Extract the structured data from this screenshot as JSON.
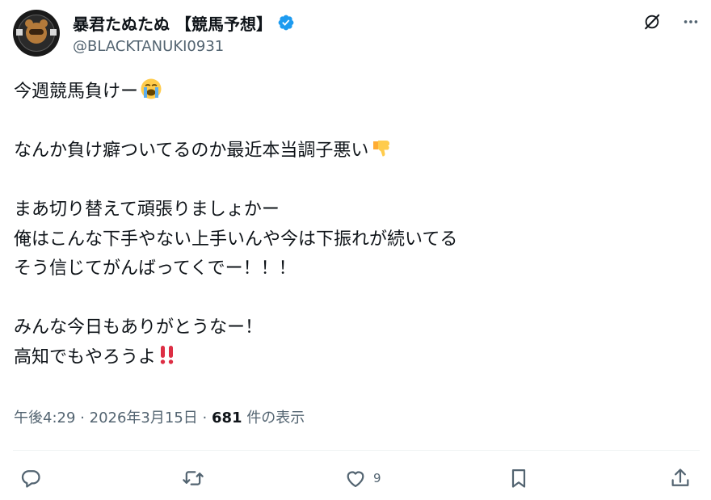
{
  "author": {
    "display_name": "暴君たぬたぬ 【競馬予想】",
    "handle": "@BLACKTANUKI0931",
    "verified": true
  },
  "tweet": {
    "lines": [
      "今週競馬負けー",
      "",
      "なんか負け癖ついてるのか最近本当調子悪い",
      "",
      "まあ切り替えて頑張りましょかー",
      "俺はこんな下手やない上手いんや今は下振れが続いてる",
      "そう信じてがんばってくでー！！！",
      "",
      "みんな今日もありがとうなー！",
      "高知でもやろうよ"
    ]
  },
  "meta": {
    "time": "午後4:29",
    "date": "2026年3月15日",
    "separator": "·",
    "views_count": "681",
    "views_label": "件の表示"
  },
  "actions": {
    "reply_count": "",
    "retweet_count": "",
    "like_count": "9"
  },
  "colors": {
    "text": "#0f1419",
    "secondary": "#536471",
    "verified": "#1d9bf0",
    "divider": "#eff3f4"
  },
  "icons": [
    "grok-icon",
    "more-icon",
    "verified-badge-icon",
    "loudly-crying-face-emoji",
    "thumbs-down-emoji",
    "double-exclamation-emoji",
    "reply-icon",
    "retweet-icon",
    "like-icon",
    "bookmark-icon",
    "share-icon"
  ]
}
